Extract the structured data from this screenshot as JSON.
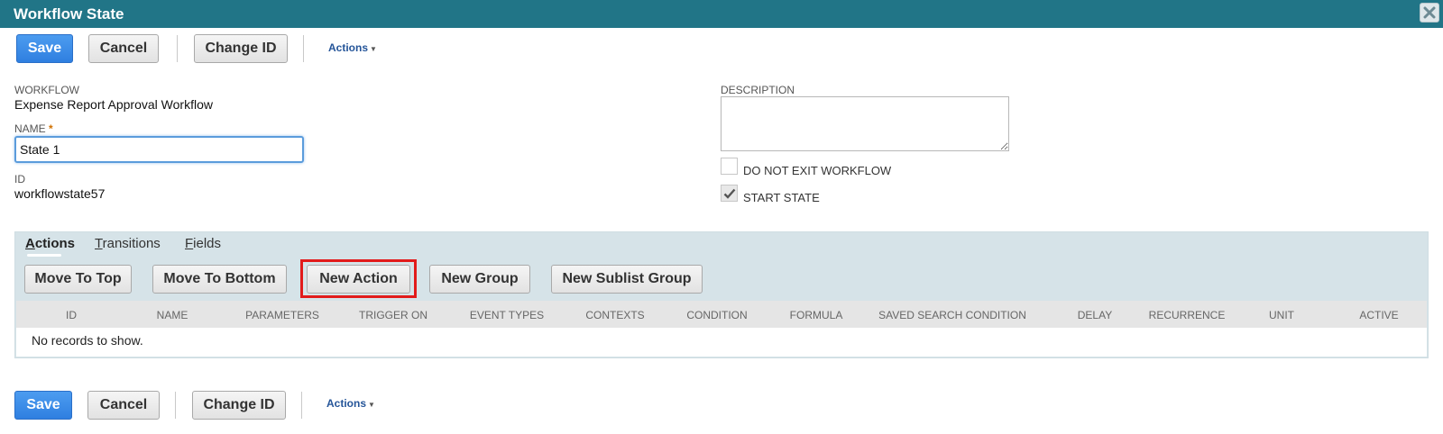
{
  "window": {
    "title": "Workflow State"
  },
  "toolbar_top": {
    "save": "Save",
    "cancel": "Cancel",
    "change_id": "Change ID",
    "actions": "Actions"
  },
  "fields": {
    "workflow_label": "WORKFLOW",
    "workflow_value": "Expense Report Approval Workflow",
    "name_label": "NAME",
    "name_required": "*",
    "name_value": "State 1",
    "id_label": "ID",
    "id_value": "workflowstate57",
    "description_label": "DESCRIPTION",
    "description_value": "",
    "do_not_exit_label": "DO NOT EXIT WORKFLOW",
    "do_not_exit_checked": false,
    "start_state_label": "START STATE",
    "start_state_checked": true
  },
  "tabs": [
    {
      "label": "Actions",
      "key": "A",
      "active": true
    },
    {
      "label": "Transitions",
      "key": "T",
      "active": false
    },
    {
      "label": "Fields",
      "key": "F",
      "active": false
    }
  ],
  "sublist_buttons": {
    "move_top": "Move To Top",
    "move_bottom": "Move To Bottom",
    "new_action": "New Action",
    "new_group": "New Group",
    "new_sublist_group": "New Sublist Group"
  },
  "grid": {
    "columns": [
      "ID",
      "NAME",
      "PARAMETERS",
      "TRIGGER ON",
      "EVENT TYPES",
      "CONTEXTS",
      "CONDITION",
      "FORMULA",
      "SAVED SEARCH CONDITION",
      "DELAY",
      "RECURRENCE",
      "UNIT",
      "ACTIVE"
    ],
    "empty_text": "No records to show."
  },
  "toolbar_bottom": {
    "save": "Save",
    "cancel": "Cancel",
    "change_id": "Change ID",
    "actions": "Actions"
  },
  "colors": {
    "titlebar": "#217587",
    "primary": "#2f7fe0",
    "highlight": "#e21b1b",
    "sublist_bg": "#d6e3e8"
  },
  "icons": {
    "close": "close-icon",
    "checkmark": "checkmark-icon",
    "caret": "caret-down-icon"
  }
}
